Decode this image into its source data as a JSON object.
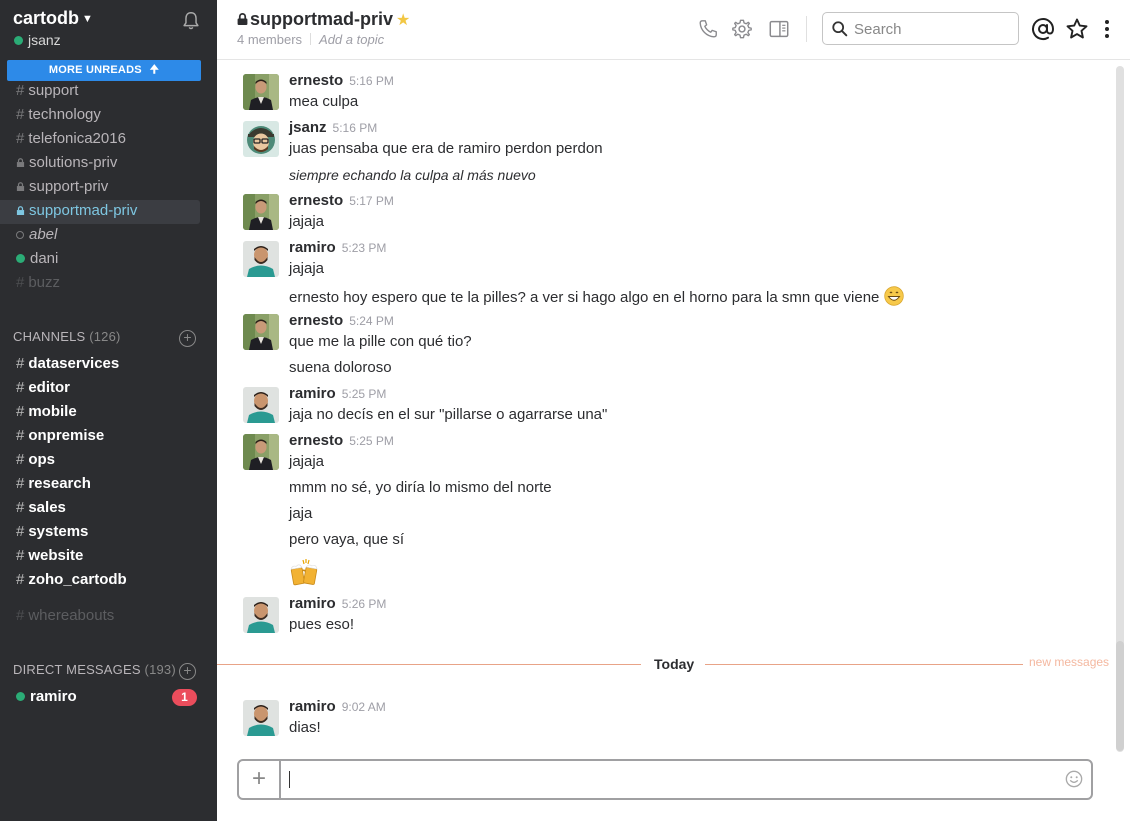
{
  "sidebar": {
    "team_name": "cartodb",
    "user": "jsanz",
    "more_unreads": "MORE UNREADS",
    "top_channels": [
      {
        "label": "support",
        "kind": "hash",
        "style": "normal"
      },
      {
        "label": "technology",
        "kind": "hash",
        "style": "normal"
      },
      {
        "label": "telefonica2016",
        "kind": "hash",
        "style": "normal"
      },
      {
        "label": "solutions-priv",
        "kind": "lock",
        "style": "normal"
      },
      {
        "label": "support-priv",
        "kind": "lock",
        "style": "normal"
      },
      {
        "label": "supportmad-priv",
        "kind": "lock",
        "style": "selected"
      },
      {
        "label": "abel",
        "kind": "away",
        "style": "italic"
      },
      {
        "label": "dani",
        "kind": "online",
        "style": "normal"
      },
      {
        "label": "buzz",
        "kind": "hash",
        "style": "muted"
      }
    ],
    "channels_header": "CHANNELS",
    "channels_count": "(126)",
    "channels": [
      "dataservices",
      "editor",
      "mobile",
      "onpremise",
      "ops",
      "research",
      "sales",
      "systems",
      "website",
      "zoho_cartodb"
    ],
    "muted_channel": "whereabouts",
    "dm_header": "DIRECT MESSAGES",
    "dm_count": "(193)",
    "dm_user": "ramiro",
    "dm_badge": "1"
  },
  "header": {
    "channel": "supportmad-priv",
    "members": "4 members",
    "topic": "Add a topic",
    "search_placeholder": "Search"
  },
  "messages": [
    {
      "sender": "ernesto",
      "time": "5:16 PM",
      "lines": [
        "mea culpa"
      ]
    },
    {
      "sender": "jsanz",
      "time": "5:16 PM",
      "lines": [
        "juas pensaba que era de ramiro perdon perdon"
      ],
      "italic": "siempre echando la culpa al más nuevo"
    },
    {
      "sender": "ernesto",
      "time": "5:17 PM",
      "lines": [
        "jajaja"
      ]
    },
    {
      "sender": "ramiro",
      "time": "5:23 PM",
      "lines": [
        "jajaja",
        "ernesto hoy espero que te la pilles? a ver si hago algo en el horno para la smn que viene"
      ]
    },
    {
      "sender": "ernesto",
      "time": "5:24 PM",
      "lines": [
        "que me la pille con qué tio?",
        "suena doloroso"
      ]
    },
    {
      "sender": "ramiro",
      "time": "5:25 PM",
      "lines": [
        "jaja no decís en el sur \"pillarse o agarrarse una\""
      ]
    },
    {
      "sender": "ernesto",
      "time": "5:25 PM",
      "lines": [
        "jajaja",
        "mmm no sé, yo diría lo mismo del norte",
        "jaja",
        "pero vaya, que sí"
      ]
    },
    {
      "sender": "ramiro",
      "time": "5:26 PM",
      "lines": [
        "pues eso!"
      ]
    },
    {
      "sender": "ramiro",
      "time": "9:02 AM",
      "lines": [
        "dias!"
      ]
    }
  ],
  "divider": {
    "label": "Today",
    "new_messages": "new messages"
  },
  "colors": {
    "sidebar_bg": "#2c2d30",
    "accent_blue": "#2d8ae8",
    "online": "#2bac76",
    "badge": "#eb4d5c",
    "divider": "#e8a387"
  }
}
